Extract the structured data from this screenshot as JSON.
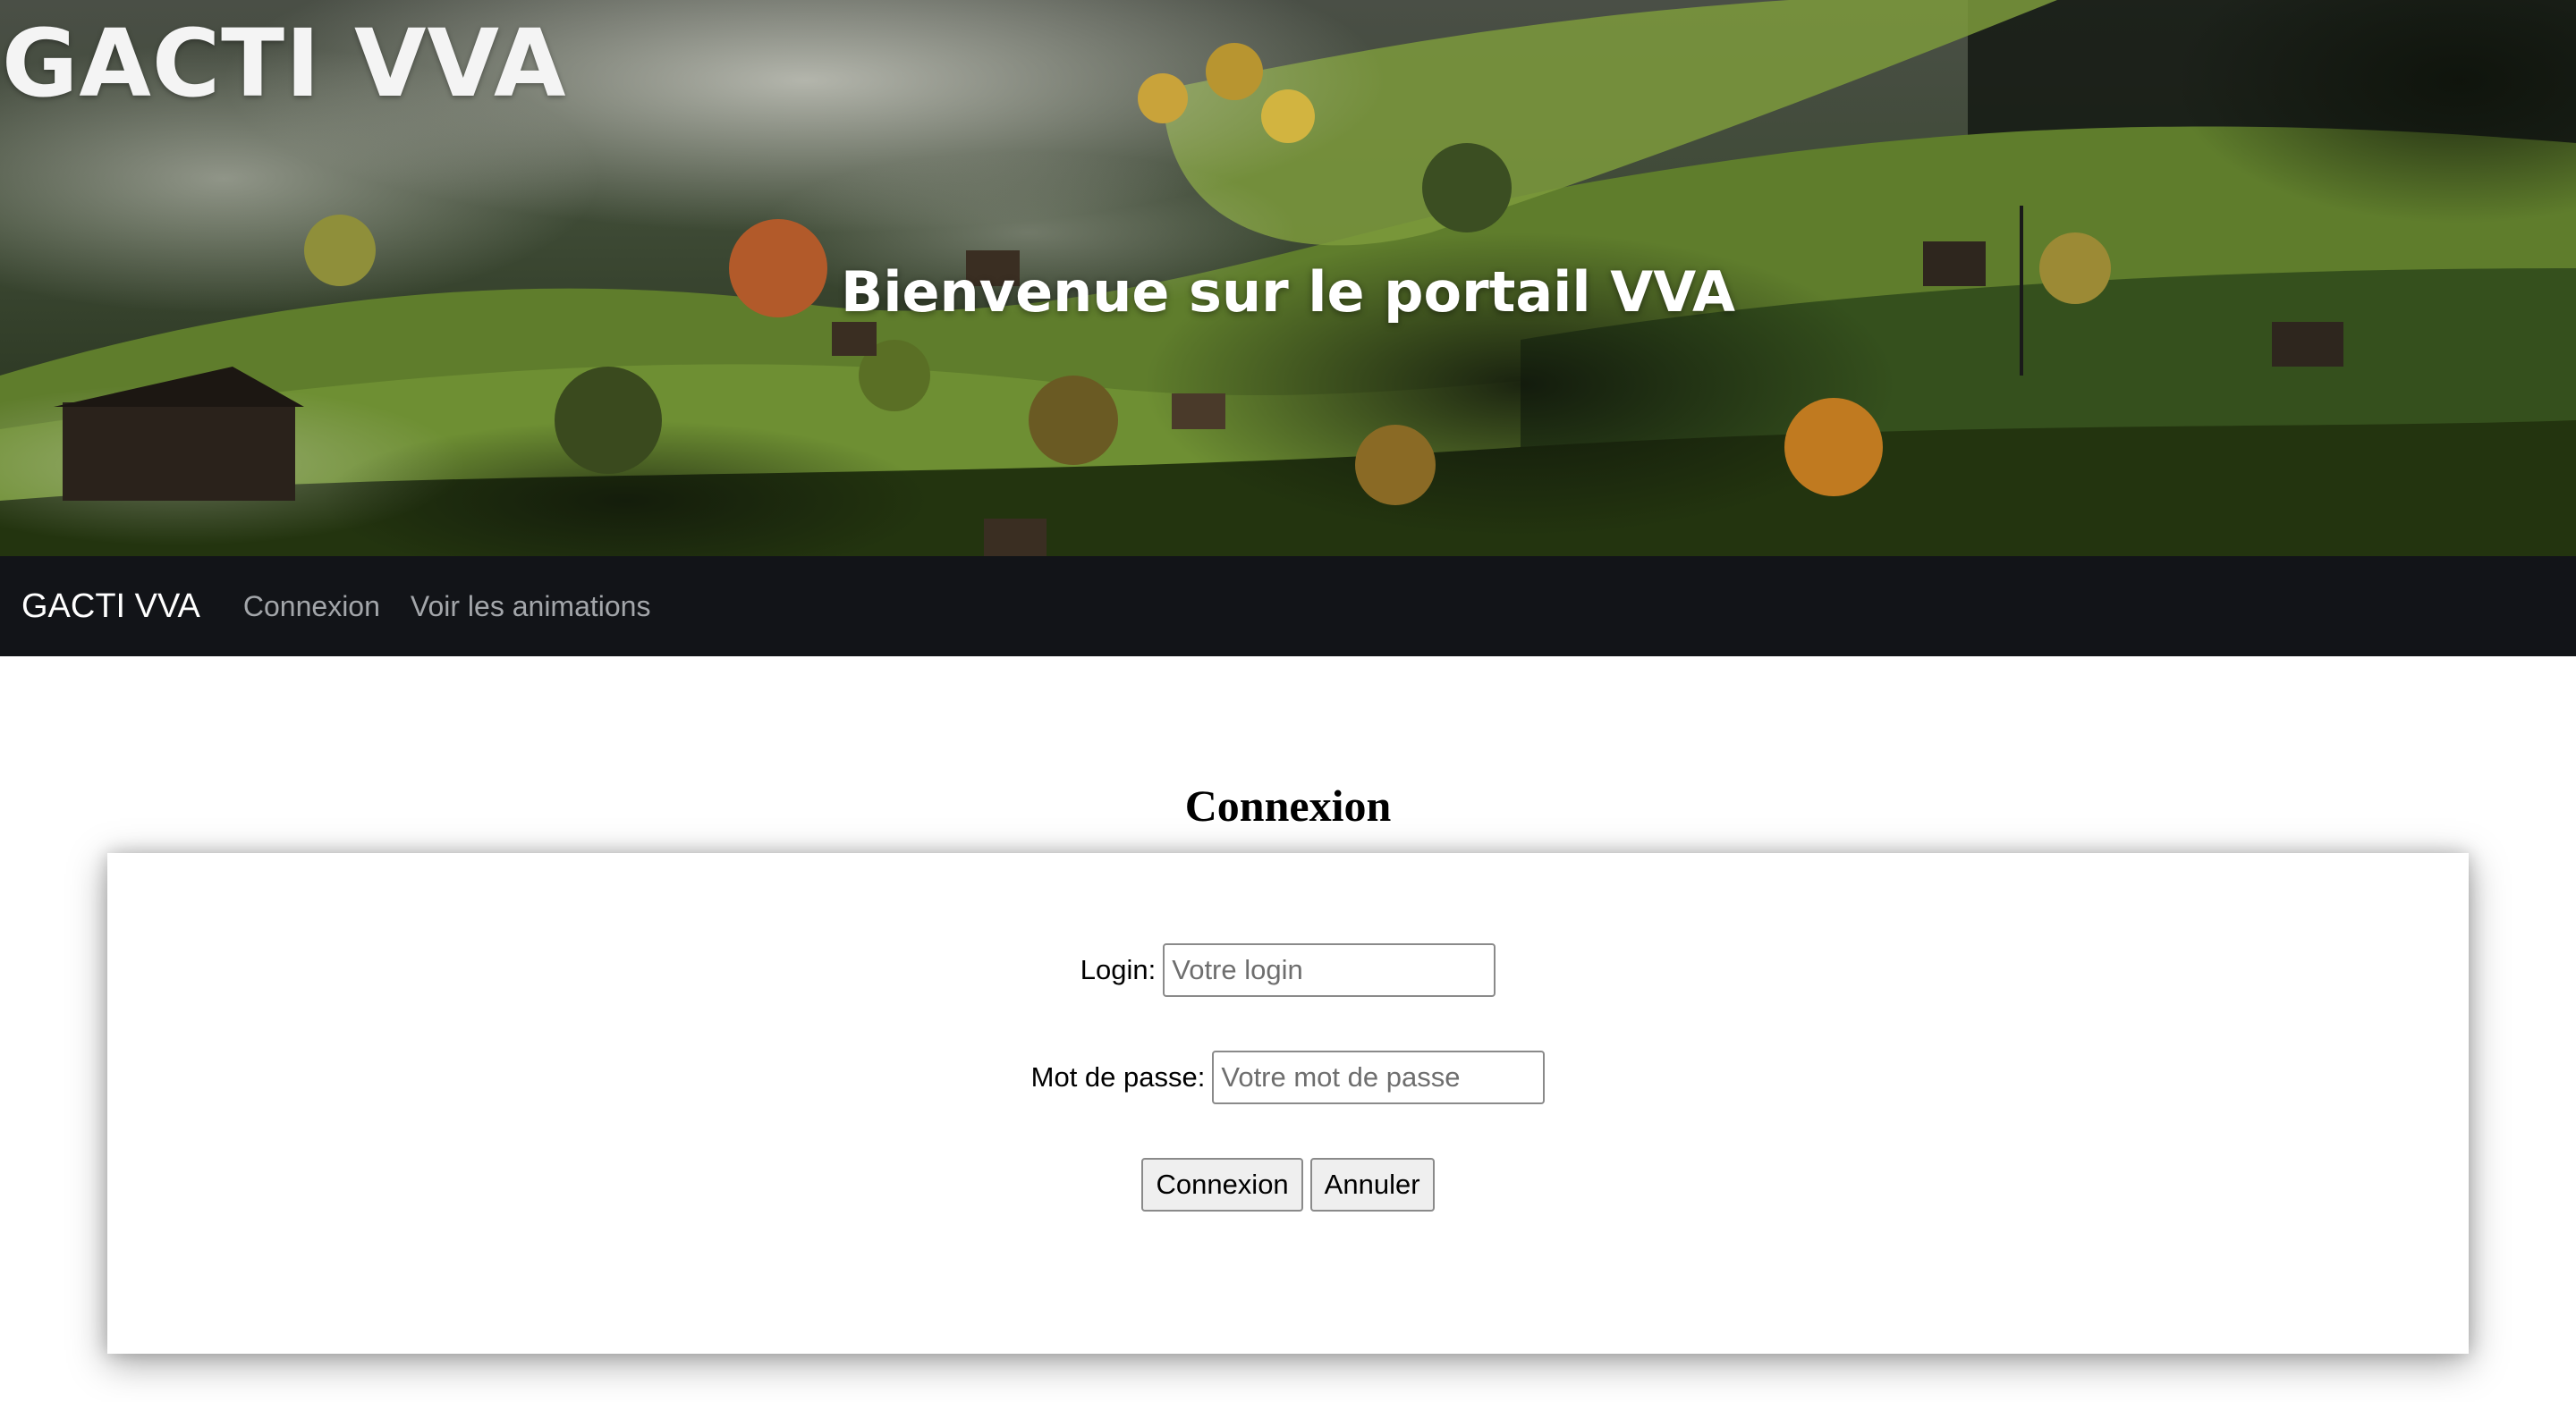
{
  "banner": {
    "title": "GACTI VVA",
    "welcome": "Bienvenue sur le portail VVA"
  },
  "navbar": {
    "brand": "GACTI VVA",
    "links": [
      {
        "label": "Connexion"
      },
      {
        "label": "Voir les animations"
      }
    ]
  },
  "login_page": {
    "heading": "Connexion",
    "login_label": "Login:",
    "login_placeholder": "Votre login",
    "password_label": "Mot de passe:",
    "password_placeholder": "Votre mot de passe",
    "submit_label": "Connexion",
    "cancel_label": "Annuler"
  },
  "colors": {
    "navbar_bg": "#121418",
    "nav_link": "#a3a6aa",
    "heading_text": "#000000"
  }
}
